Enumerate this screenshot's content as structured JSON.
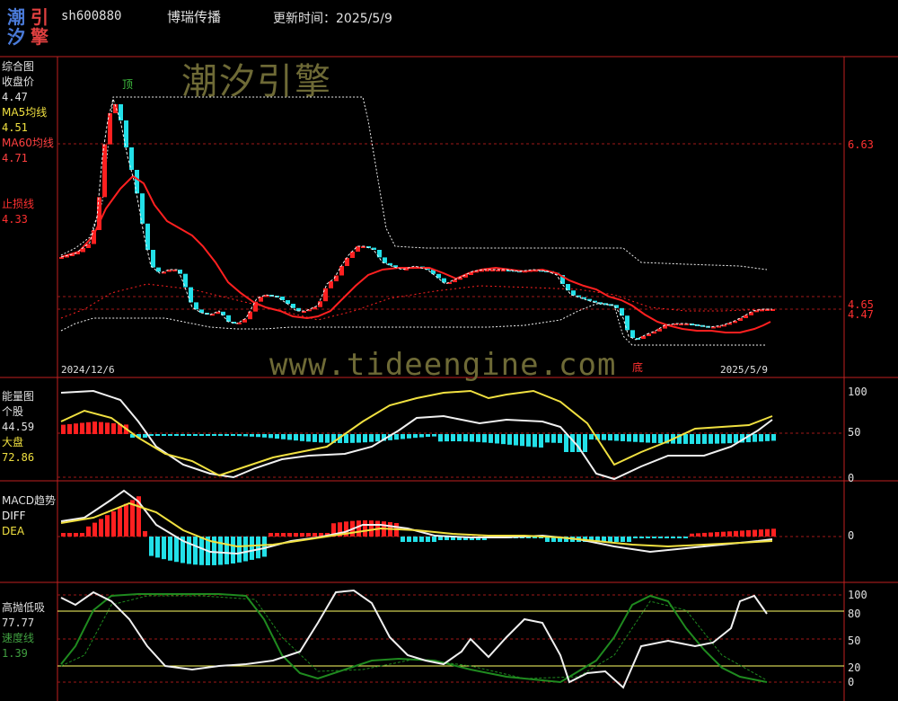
{
  "colors": {
    "red": "#ff2020",
    "cyan": "#22e0e8",
    "yellow": "#f0e040",
    "white": "#f0f0f0",
    "green": "#1f8a1f",
    "grid": "#a01818",
    "lime": "#ffff66"
  },
  "logo": {
    "c1": "潮",
    "c2": "引",
    "c3": "汐",
    "c4": "擎"
  },
  "header": {
    "code": "sh600880",
    "name": "博瑞传播",
    "update_label": "更新时间：2025/5/9"
  },
  "main": {
    "title": "综合图",
    "close_label": "收盘价",
    "close_value": "4.47",
    "ma5_label": "MA5均线",
    "ma5_value": "4.51",
    "ma60_label": "MA60均线",
    "ma60_value": "4.71",
    "stop_label": "止损线",
    "stop_value": "4.33",
    "right_ticks": [
      "6.63",
      "4.65",
      "4.47"
    ],
    "date_start": "2024/12/6",
    "date_end": "2025/5/9",
    "top_mark": "顶",
    "bottom_mark": "底"
  },
  "energy": {
    "title": "能量图",
    "stock_label": "个股",
    "stock_value": "44.59",
    "market_label": "大盘",
    "market_value": "72.86",
    "ticks": [
      "100",
      "50",
      "0"
    ]
  },
  "macd": {
    "title": "MACD趋势",
    "diff_label": "DIFF",
    "dea_label": "DEA",
    "ticks": [
      "0"
    ]
  },
  "hl": {
    "title": "高抛低吸",
    "value": "77.77",
    "speed_label": "速度线",
    "speed_value": "1.39",
    "ticks": [
      "100",
      "80",
      "50",
      "20",
      "0"
    ]
  },
  "watermark": {
    "cn": "潮汐引擎",
    "url": "www.tideengine.com"
  }
}
